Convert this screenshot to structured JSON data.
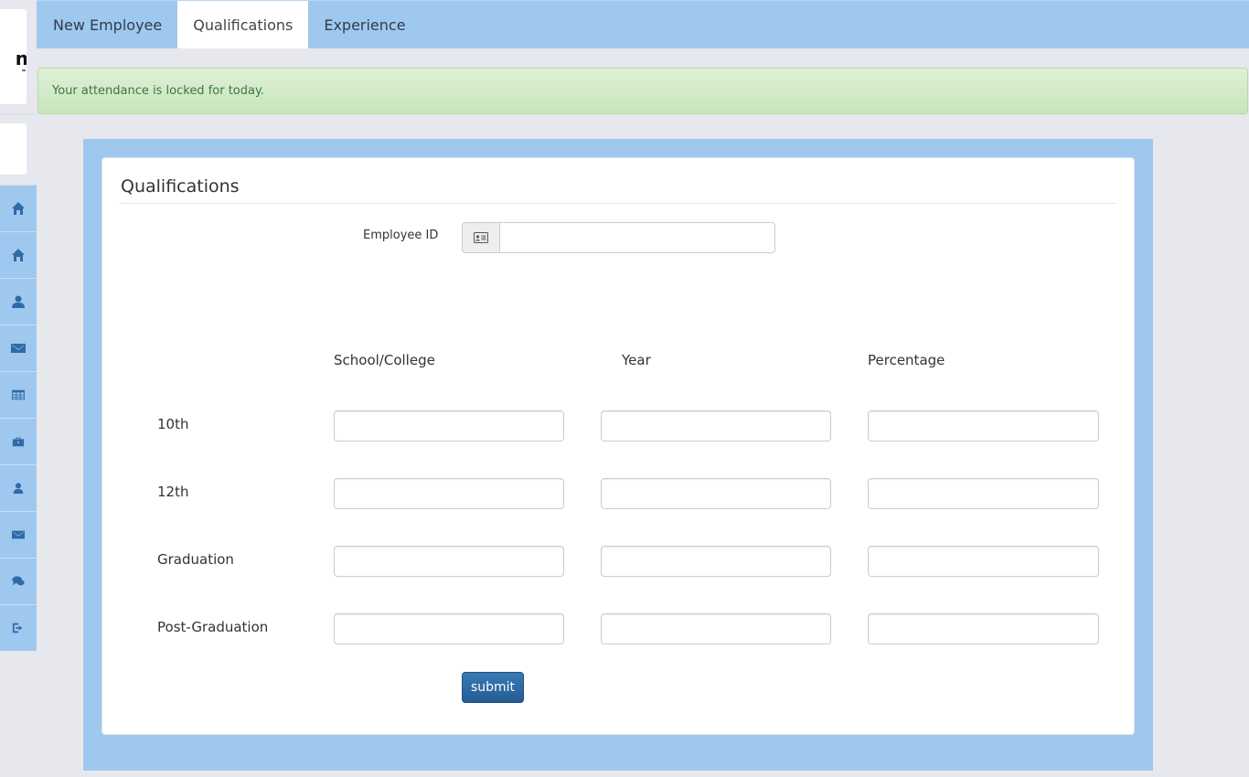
{
  "tabs": [
    {
      "label": "New Employee",
      "active": false
    },
    {
      "label": "Qualifications",
      "active": true
    },
    {
      "label": "Experience",
      "active": false
    }
  ],
  "alert": {
    "text": "Your attendance is locked for today."
  },
  "sidebar": {
    "logo_glyph": "n",
    "items": [
      {
        "icon": "home-icon"
      },
      {
        "icon": "home-icon"
      },
      {
        "icon": "user-icon"
      },
      {
        "icon": "envelope-icon"
      },
      {
        "icon": "table-icon"
      },
      {
        "icon": "briefcase-icon"
      },
      {
        "icon": "user-icon"
      },
      {
        "icon": "envelope-icon"
      },
      {
        "icon": "comments-icon"
      },
      {
        "icon": "logout-icon"
      }
    ]
  },
  "form": {
    "title": "Qualifications",
    "employee_id_label": "Employee ID",
    "employee_id_value": "",
    "columns": [
      "School/College",
      "Year",
      "Percentage"
    ],
    "rows": [
      {
        "label": "10th",
        "values": [
          "",
          "",
          ""
        ]
      },
      {
        "label": "12th",
        "values": [
          "",
          "",
          ""
        ]
      },
      {
        "label": "Graduation",
        "values": [
          "",
          "",
          ""
        ]
      },
      {
        "label": "Post-Graduation",
        "values": [
          "",
          "",
          ""
        ]
      }
    ],
    "submit_label": "submit"
  },
  "colors": {
    "accent_blue": "#9fc8ef",
    "icon_blue": "#2f6aa8",
    "alert_green_bg": "#dff0d8",
    "alert_green_text": "#3c763d",
    "button_blue": "#2a68a3"
  }
}
